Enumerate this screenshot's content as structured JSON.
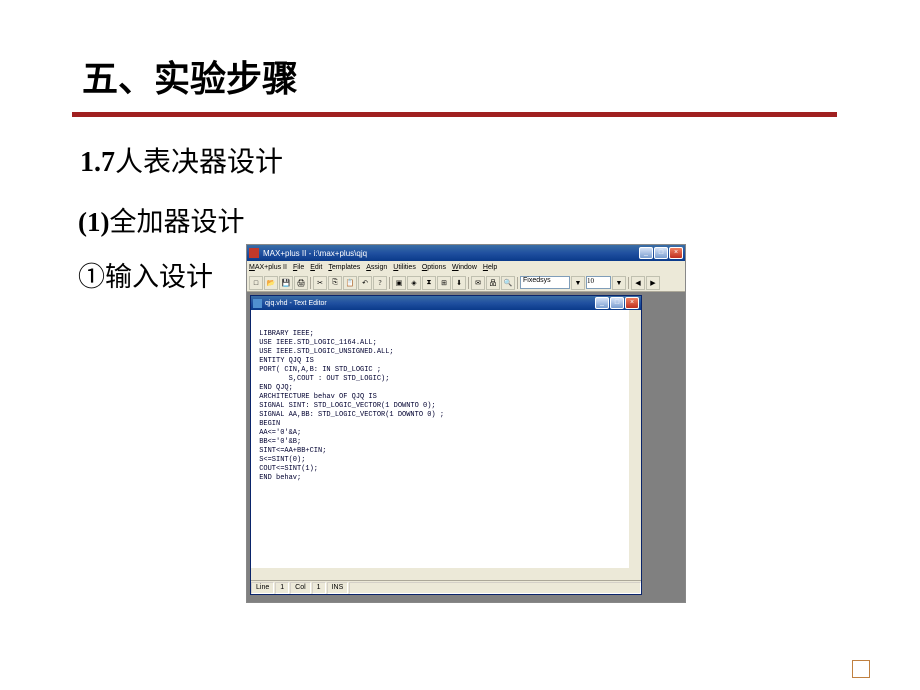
{
  "slide": {
    "title": "五、实验步骤",
    "heading1": {
      "prefix": "1.7",
      "text": "人表决器设计"
    },
    "heading2": {
      "prefix": "(1)",
      "text": "全加器设计"
    },
    "heading3": "①输入设计"
  },
  "app": {
    "title": "MAX+plus II - i:\\max+plus\\qjq",
    "menus": [
      "MAX+plus II",
      "File",
      "Edit",
      "Templates",
      "Assign",
      "Utilities",
      "Options",
      "Window",
      "Help"
    ],
    "font_name": "Fixedsys",
    "font_size": "10"
  },
  "editor": {
    "title": "qjq.vhd - Text Editor",
    "code": [
      " LIBRARY IEEE;",
      " USE IEEE.STD_LOGIC_1164.ALL;",
      " USE IEEE.STD_LOGIC_UNSIGNED.ALL;",
      " ENTITY QJQ IS",
      " PORT( CIN,A,B: IN STD_LOGIC ;",
      "        S,COUT : OUT STD_LOGIC);",
      " END QJQ;",
      " ARCHITECTURE behav OF QJQ IS",
      " SIGNAL SINT: STD_LOGIC_VECTOR(1 DOWNTO 0);",
      " SIGNAL AA,BB: STD_LOGIC_VECTOR(1 DOWNTO 0) ;",
      " BEGIN",
      " AA<='0'&A;",
      " BB<='0'&B;",
      " SINT<=AA+BB+CIN;",
      " S<=SINT(0);",
      " COUT<=SINT(1);",
      " END behav;"
    ],
    "status": {
      "line_label": "Line",
      "line_val": "1",
      "col_label": "Col",
      "col_val": "1",
      "ins": "INS"
    }
  },
  "win_controls": {
    "minimize": "_",
    "maximize": "□",
    "close": "×"
  },
  "toolbar_icons": [
    {
      "name": "new-icon",
      "glyph": "□"
    },
    {
      "name": "open-icon",
      "glyph": "📂"
    },
    {
      "name": "save-icon",
      "glyph": "💾"
    },
    {
      "name": "print-icon",
      "glyph": "🖨"
    },
    {
      "name": "cut-icon",
      "glyph": "✂"
    },
    {
      "name": "copy-icon",
      "glyph": "⎘"
    },
    {
      "name": "paste-icon",
      "glyph": "📋"
    },
    {
      "name": "undo-icon",
      "glyph": "↶"
    },
    {
      "name": "help-icon",
      "glyph": "?"
    },
    {
      "name": "compile-icon",
      "glyph": "▣"
    },
    {
      "name": "sim-icon",
      "glyph": "◈"
    },
    {
      "name": "timing-icon",
      "glyph": "⧗"
    },
    {
      "name": "floorplan-icon",
      "glyph": "⊞"
    },
    {
      "name": "prog-icon",
      "glyph": "⬇"
    },
    {
      "name": "msg-icon",
      "glyph": "✉"
    },
    {
      "name": "hierarchy-icon",
      "glyph": "品"
    },
    {
      "name": "search-icon",
      "glyph": "🔍"
    }
  ]
}
